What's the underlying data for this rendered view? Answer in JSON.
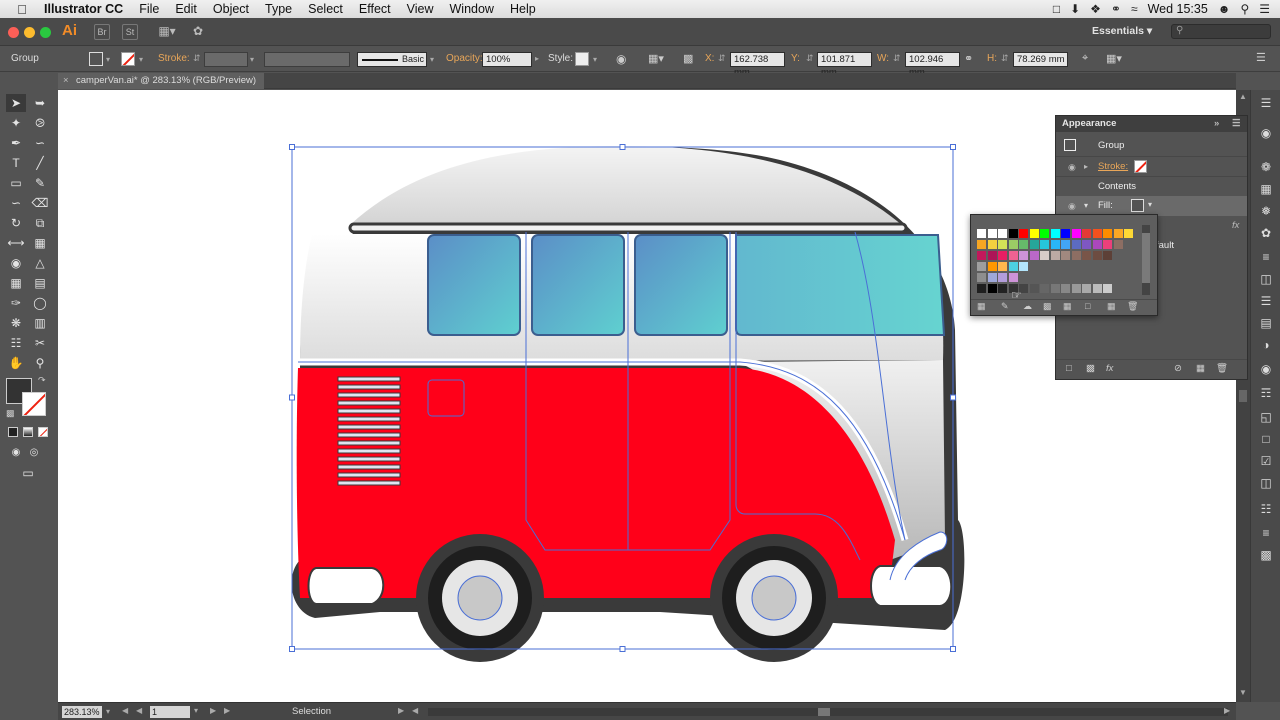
{
  "menubar": {
    "app_name": "Illustrator CC",
    "items": [
      "File",
      "Edit",
      "Object",
      "Type",
      "Select",
      "Effect",
      "View",
      "Window",
      "Help"
    ],
    "clock": "Wed 15:35"
  },
  "appbar": {
    "logo": "Ai",
    "bridge_label": "Br",
    "stock_label": "St",
    "workspace": "Essentials",
    "search_placeholder": ""
  },
  "control_bar": {
    "selection_type": "Group",
    "stroke_label": "Stroke:",
    "brush_label": "Basic",
    "opacity_label": "Opacity:",
    "opacity_value": "100%",
    "style_label": "Style:",
    "x_label": "X:",
    "x_value": "162.738 mm",
    "y_label": "Y:",
    "y_value": "101.871 mm",
    "w_label": "W:",
    "w_value": "102.946 mm",
    "h_label": "H:",
    "h_value": "78.269 mm"
  },
  "document": {
    "tab_title": "camperVan.ai* @ 283.13% (RGB/Preview)"
  },
  "status_bar": {
    "zoom": "283.13%",
    "artboard_number": "1",
    "tool_name": "Selection"
  },
  "appearance_panel": {
    "title": "Appearance",
    "object_label": "Group",
    "stroke_label": "Stroke:",
    "contents_label": "Contents",
    "fill_label": "Fill:",
    "partial_opacity": "fault",
    "fx_label": "fx"
  },
  "colors": {
    "van_red": "#ff0019",
    "van_outline": "#3a3a3a",
    "window_top": "#5b8ec7",
    "window_bottom": "#5fd0d0",
    "selection_blue": "#4a6fd6",
    "orange_accent": "#e8a659"
  }
}
